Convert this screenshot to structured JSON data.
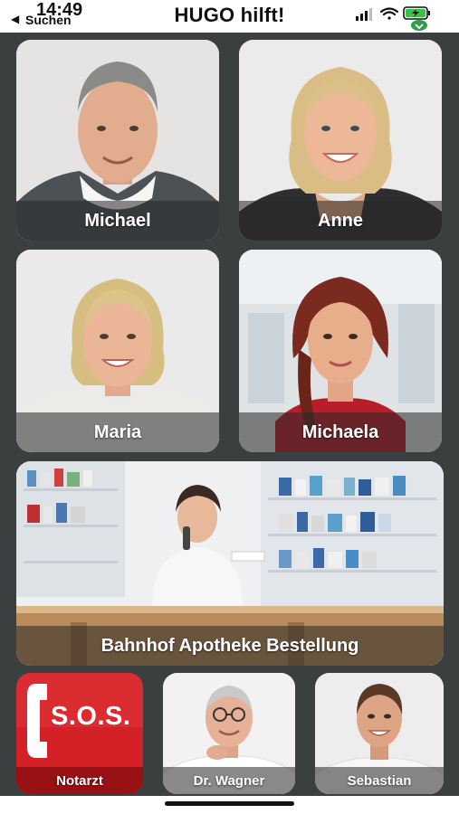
{
  "status_bar": {
    "time": "14:49",
    "back_label": "Suchen",
    "icons": [
      "signal-icon",
      "wifi-icon",
      "battery-charging-icon",
      "location-icon"
    ]
  },
  "app": {
    "title": "HUGO hilft!"
  },
  "contacts": [
    {
      "name": "Michael"
    },
    {
      "name": "Anne"
    },
    {
      "name": "Maria"
    },
    {
      "name": "Michaela"
    }
  ],
  "pharmacy": {
    "label": "Bahnhof Apotheke Bestellung"
  },
  "bottom_row": {
    "sos": {
      "badge": "S.O.S.",
      "label": "Notarzt",
      "color": "#d42027"
    },
    "doctor": {
      "label": "Dr. Wagner"
    },
    "person": {
      "label": "Sebastian"
    }
  }
}
